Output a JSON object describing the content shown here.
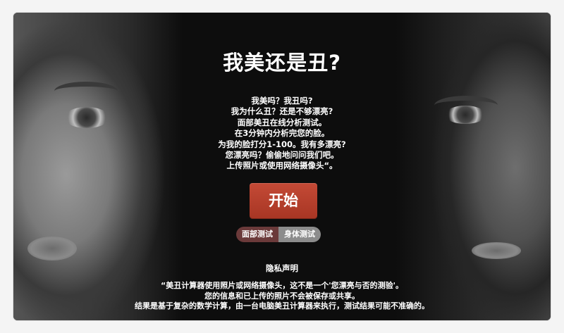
{
  "header": {
    "title": "我美还是丑?"
  },
  "intro": {
    "lines": [
      "我美吗？我丑吗?",
      "我为什么丑？还是不够漂亮?",
      "面部美丑在线分析测试。",
      "在3分钟内分析完您的脸。",
      "为我的脸打分1-100。我有多漂亮?",
      "您漂亮吗？偷偷地问问我们吧。",
      "上传照片或使用网络摄像头“。"
    ]
  },
  "actions": {
    "start_label": "开始"
  },
  "tabs": [
    {
      "label": "面部测试",
      "active": true
    },
    {
      "label": "身体测试",
      "active": false
    }
  ],
  "privacy": {
    "title": "隐私声明",
    "lines": [
      "“美丑计算器使用照片或网络摄像头，这不是一个'您漂亮与否的测验'。",
      "您的信息和已上传的照片不会被保存或共享。",
      "结果是基于复杂的数学计算，由一台电脑美丑计算器来执行，测试结果可能不准确的。"
    ]
  },
  "colors": {
    "background": "#0d0d0d",
    "start_button": "#b53f2c",
    "tab_active": "#6b3a3a",
    "tab_inactive": "#8c8c8c",
    "text": "#ffffff"
  }
}
